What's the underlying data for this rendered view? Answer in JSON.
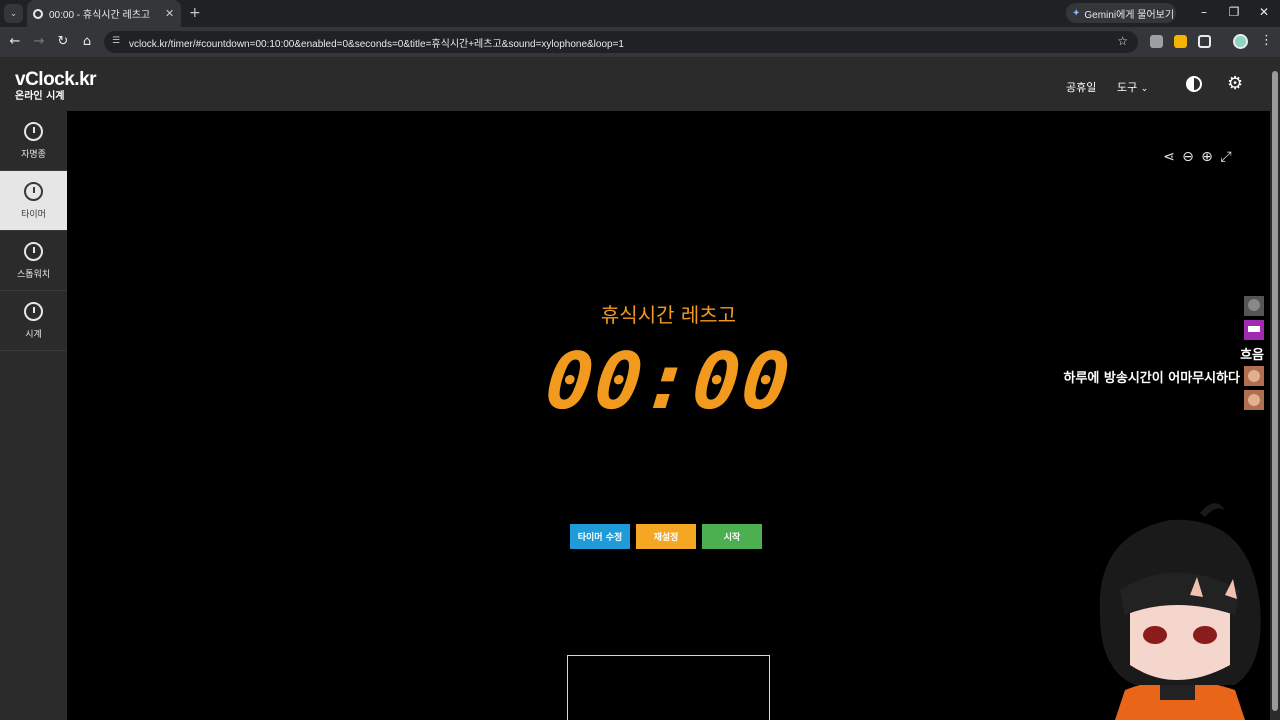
{
  "browser": {
    "tab_title": "00:00 - 휴식시간 레츠고",
    "url": "vclock.kr/timer/#countdown=00:10:00&enabled=0&seconds=0&title=휴식시간+레츠고&sound=xylophone&loop=1",
    "gemini_label": "Gemini에게 물어보기"
  },
  "header": {
    "logo": "vClock.kr",
    "logo_sub": "온라인 시계",
    "nav": {
      "holidays": "공휴일",
      "tools": "도구"
    }
  },
  "sidebar": {
    "items": [
      {
        "label": "자명종",
        "icon": "alarm-clock-icon",
        "active": false
      },
      {
        "label": "타이머",
        "icon": "timer-icon",
        "active": true
      },
      {
        "label": "스톱워치",
        "icon": "stopwatch-icon",
        "active": false
      },
      {
        "label": "시계",
        "icon": "clock-icon",
        "active": false
      }
    ]
  },
  "timer": {
    "title": "휴식시간 레츠고",
    "display": "00:00",
    "buttons": {
      "edit": "타이머 수정",
      "reset": "재설정",
      "start": "시작"
    }
  },
  "overlay": {
    "chat": [
      {
        "text": "흐음"
      },
      {
        "text": "하루에 방송시간이 어마무시하다"
      }
    ]
  },
  "colors": {
    "accent": "#f29a1e",
    "edit_button": "#1e9bd8",
    "reset_button": "#f5a623",
    "start_button": "#4caf50"
  }
}
